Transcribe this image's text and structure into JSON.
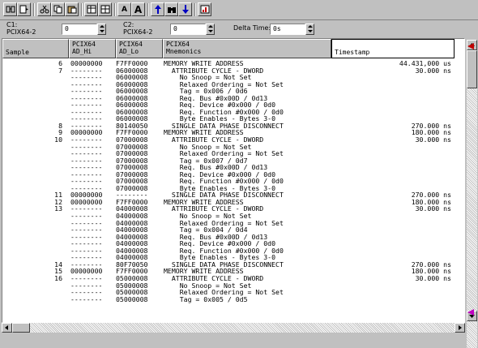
{
  "toolbar": {
    "buttons": [
      "pin-icon",
      "run-icon",
      "cut-icon",
      "copy-icon",
      "paste-icon",
      "table-icon",
      "grid-icon",
      "font-small-icon",
      "font-large-icon",
      "arrow-up-icon",
      "binoculars-icon",
      "arrow-down-icon",
      "chart-icon"
    ],
    "font_small": "A",
    "font_large": "A"
  },
  "controls": {
    "c1_label": "C1:",
    "c1_source": "PCIX64-2",
    "c1_value": "0",
    "c2_label": "C2:",
    "c2_source": "PCIX64-2",
    "c2_value": "0",
    "delta_label": "Delta Time:",
    "delta_value": "0s"
  },
  "columns": {
    "sample": "Sample",
    "adhi": [
      "PCIX64",
      "AD_Hi"
    ],
    "adlo": [
      "PCIX64",
      "AD_Lo"
    ],
    "mnem": [
      "PCIX64",
      "Mnemonics"
    ],
    "ts": "Timestamp"
  },
  "rows": [
    [
      "6",
      "00000000",
      "F7FF0000",
      "MEMORY WRITE ADDRESS",
      "44.431,000 us"
    ],
    [
      "7",
      "--------",
      "06000008",
      "  ATTRIBUTE CYCLE - DWORD",
      "30.000 ns"
    ],
    [
      "",
      "--------",
      "06000008",
      "    No Snoop = Not Set",
      ""
    ],
    [
      "",
      "--------",
      "06000008",
      "    Relaxed Ordering = Not Set",
      ""
    ],
    [
      "",
      "--------",
      "06000008",
      "    Tag = 0x006 / 0d6",
      ""
    ],
    [
      "",
      "--------",
      "06000008",
      "    Req. Bus #0x00D / 0d13",
      ""
    ],
    [
      "",
      "--------",
      "06000008",
      "    Req. Device #0x000 / 0d0",
      ""
    ],
    [
      "",
      "--------",
      "06000008",
      "    Req. Function #0x000 / 0d0",
      ""
    ],
    [
      "",
      "--------",
      "06000008",
      "    Byte Enables - Bytes 3-0",
      ""
    ],
    [
      "8",
      "--------",
      "80140050",
      "  SINGLE DATA PHASE DISCONNECT",
      "270.000 ns"
    ],
    [
      "9",
      "00000000",
      "F7FF0000",
      "MEMORY WRITE ADDRESS",
      "180.000 ns"
    ],
    [
      "10",
      "--------",
      "07000008",
      "  ATTRIBUTE CYCLE - DWORD",
      "30.000 ns"
    ],
    [
      "",
      "--------",
      "07000008",
      "    No Snoop = Not Set",
      ""
    ],
    [
      "",
      "--------",
      "07000008",
      "    Relaxed Ordering = Not Set",
      ""
    ],
    [
      "",
      "--------",
      "07000008",
      "    Tag = 0x007 / 0d7",
      ""
    ],
    [
      "",
      "--------",
      "07000008",
      "    Req. Bus #0x00D / 0d13",
      ""
    ],
    [
      "",
      "--------",
      "07000008",
      "    Req. Device #0x000 / 0d0",
      ""
    ],
    [
      "",
      "--------",
      "07000008",
      "    Req. Function #0x000 / 0d0",
      ""
    ],
    [
      "",
      "--------",
      "07000008",
      "    Byte Enables - Bytes 3-0",
      ""
    ],
    [
      "11",
      "00000000",
      "--------",
      "  SINGLE DATA PHASE DISCONNECT",
      "270.000 ns"
    ],
    [
      "12",
      "00000000",
      "F7FF0000",
      "MEMORY WRITE ADDRESS",
      "180.000 ns"
    ],
    [
      "13",
      "--------",
      "04000008",
      "  ATTRIBUTE CYCLE - DWORD",
      "30.000 ns"
    ],
    [
      "",
      "--------",
      "04000008",
      "    No Snoop = Not Set",
      ""
    ],
    [
      "",
      "--------",
      "04000008",
      "    Relaxed Ordering = Not Set",
      ""
    ],
    [
      "",
      "--------",
      "04000008",
      "    Tag = 0x004 / 0d4",
      ""
    ],
    [
      "",
      "--------",
      "04000008",
      "    Req. Bus #0x00D / 0d13",
      ""
    ],
    [
      "",
      "--------",
      "04000008",
      "    Req. Device #0x000 / 0d0",
      ""
    ],
    [
      "",
      "--------",
      "04000008",
      "    Req. Function #0x000 / 0d0",
      ""
    ],
    [
      "",
      "--------",
      "04000008",
      "    Byte Enables - Bytes 3-0",
      ""
    ],
    [
      "14",
      "--------",
      "80F70050",
      "  SINGLE DATA PHASE DISCONNECT",
      "270.000 ns"
    ],
    [
      "15",
      "00000000",
      "F7FF0000",
      "MEMORY WRITE ADDRESS",
      "180.000 ns"
    ],
    [
      "16",
      "--------",
      "05000008",
      "  ATTRIBUTE CYCLE - DWORD",
      "30.000 ns"
    ],
    [
      "",
      "--------",
      "05000008",
      "    No Snoop = Not Set",
      ""
    ],
    [
      "",
      "--------",
      "05000008",
      "    Relaxed Ordering = Not Set",
      ""
    ],
    [
      "",
      "--------",
      "05000008",
      "    Tag = 0x005 / 0d5",
      ""
    ]
  ],
  "colors": {
    "marker_red": "#c00000",
    "marker_magenta": "#c000c0",
    "arrow_blue": "#0000c0"
  }
}
